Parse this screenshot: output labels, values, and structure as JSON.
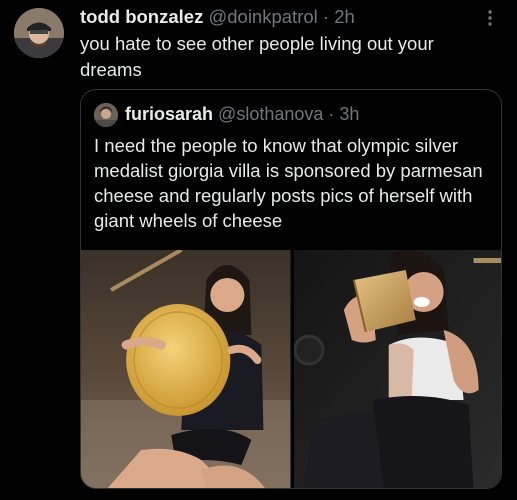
{
  "tweet": {
    "author_name": "todd bonzalez",
    "author_handle": "@doinkpatrol",
    "separator": "·",
    "time": "2h",
    "text": "you hate to see other people living out your dreams",
    "avatar_icon": "user-avatar"
  },
  "quoted": {
    "author_name": "furiosarah",
    "author_handle": "@slothanova",
    "separator": "·",
    "time": "3h",
    "text": "I need the people to know that olympic silver medalist giorgia villa is sponsored by parmesan cheese and regularly posts pics of herself with giant wheels of cheese",
    "avatar_icon": "user-avatar",
    "media_icons": [
      "photo-cheese-wheel-seated",
      "photo-cheese-wedge-bite"
    ]
  },
  "colors": {
    "background": "#000000",
    "primary_text": "#e7e9ea",
    "secondary_text": "#71767b",
    "border": "#2f3336"
  }
}
